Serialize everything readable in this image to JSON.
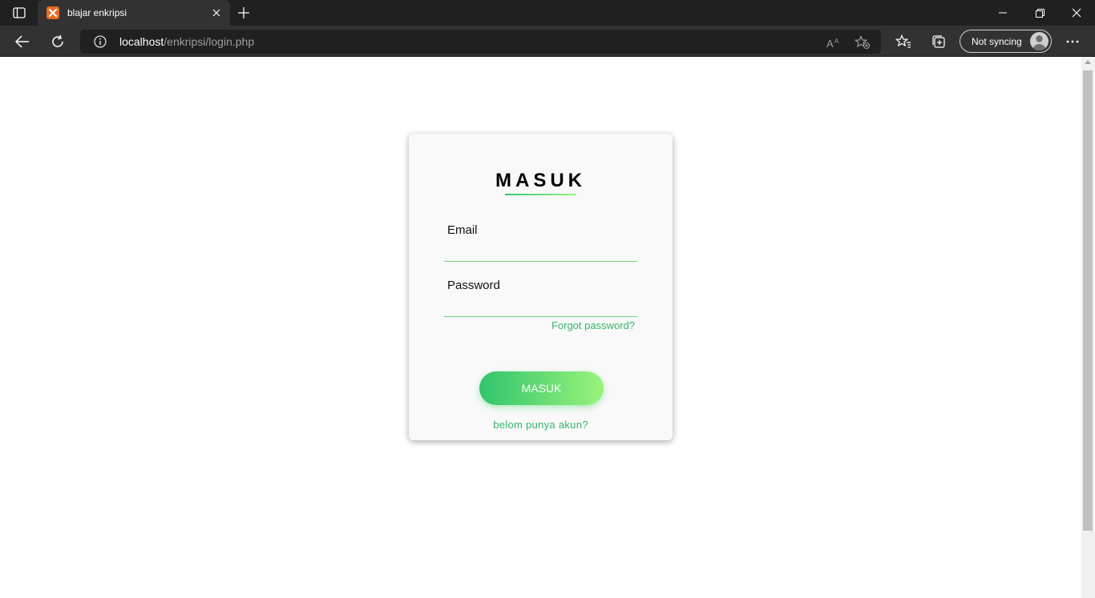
{
  "browser": {
    "tab_title": "blajar enkripsi",
    "url_host": "localhost",
    "url_path": "/enkripsi/login.php",
    "profile_label": "Not syncing",
    "colors": {
      "titlebar": "#202020",
      "toolbar": "#323232",
      "favicon": "#e86b1e"
    }
  },
  "login": {
    "title": "MASUK",
    "email_label": "Email",
    "email_value": "",
    "password_label": "Password",
    "password_value": "",
    "forgot_link": "Forgot password?",
    "submit_label": "MASUK",
    "signup_link": "belom punya akun?",
    "colors": {
      "accent": "#37b56a",
      "button_start": "#31c46c",
      "button_end": "#9af37b"
    }
  }
}
